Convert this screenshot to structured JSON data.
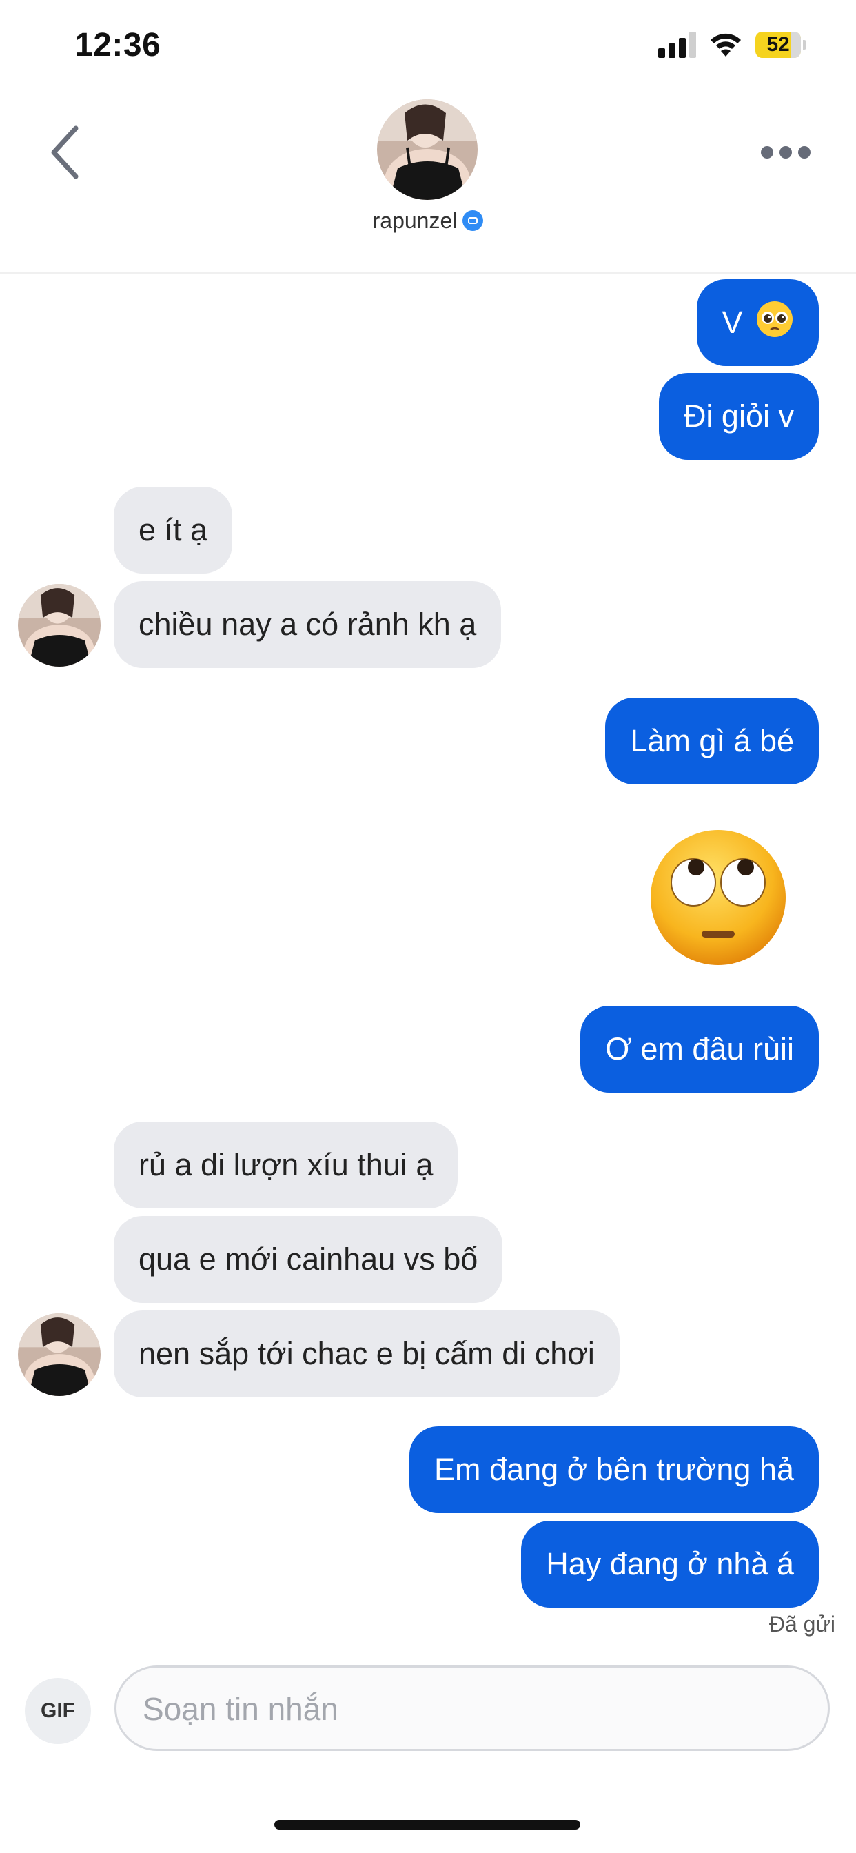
{
  "status_bar": {
    "time": "12:36",
    "battery": "52"
  },
  "header": {
    "name": "rapunzel"
  },
  "messages": [
    {
      "side": "sent",
      "text": "V",
      "emoji": "pleading-face"
    },
    {
      "side": "sent",
      "text": "Đi giỏi v"
    },
    {
      "side": "recv",
      "text": "e ít ạ"
    },
    {
      "side": "recv",
      "text": "chiều nay a có rảnh kh ạ"
    },
    {
      "side": "sent",
      "text": "Làm gì á bé"
    },
    {
      "side": "sent",
      "emoji": "face-with-rolling-eyes"
    },
    {
      "side": "sent",
      "text": "Ơ em đâu rùii"
    },
    {
      "side": "recv",
      "text": "rủ a di lượn xíu thui ạ"
    },
    {
      "side": "recv",
      "text": "qua e mới cainhau vs bố"
    },
    {
      "side": "recv",
      "text": "nen sắp tới chac e bị cấm di chơi"
    },
    {
      "side": "sent",
      "text": "Em đang ở bên trường hả"
    },
    {
      "side": "sent",
      "text": "Hay đang ở nhà á"
    }
  ],
  "sent_status": "Đã gửi",
  "composer": {
    "gif_label": "GIF",
    "placeholder": "Soạn tin nhắn"
  },
  "colors": {
    "sent_bubble": "#0b5fe0",
    "received_bubble": "#e9eaee",
    "verified": "#2f8cf5"
  }
}
